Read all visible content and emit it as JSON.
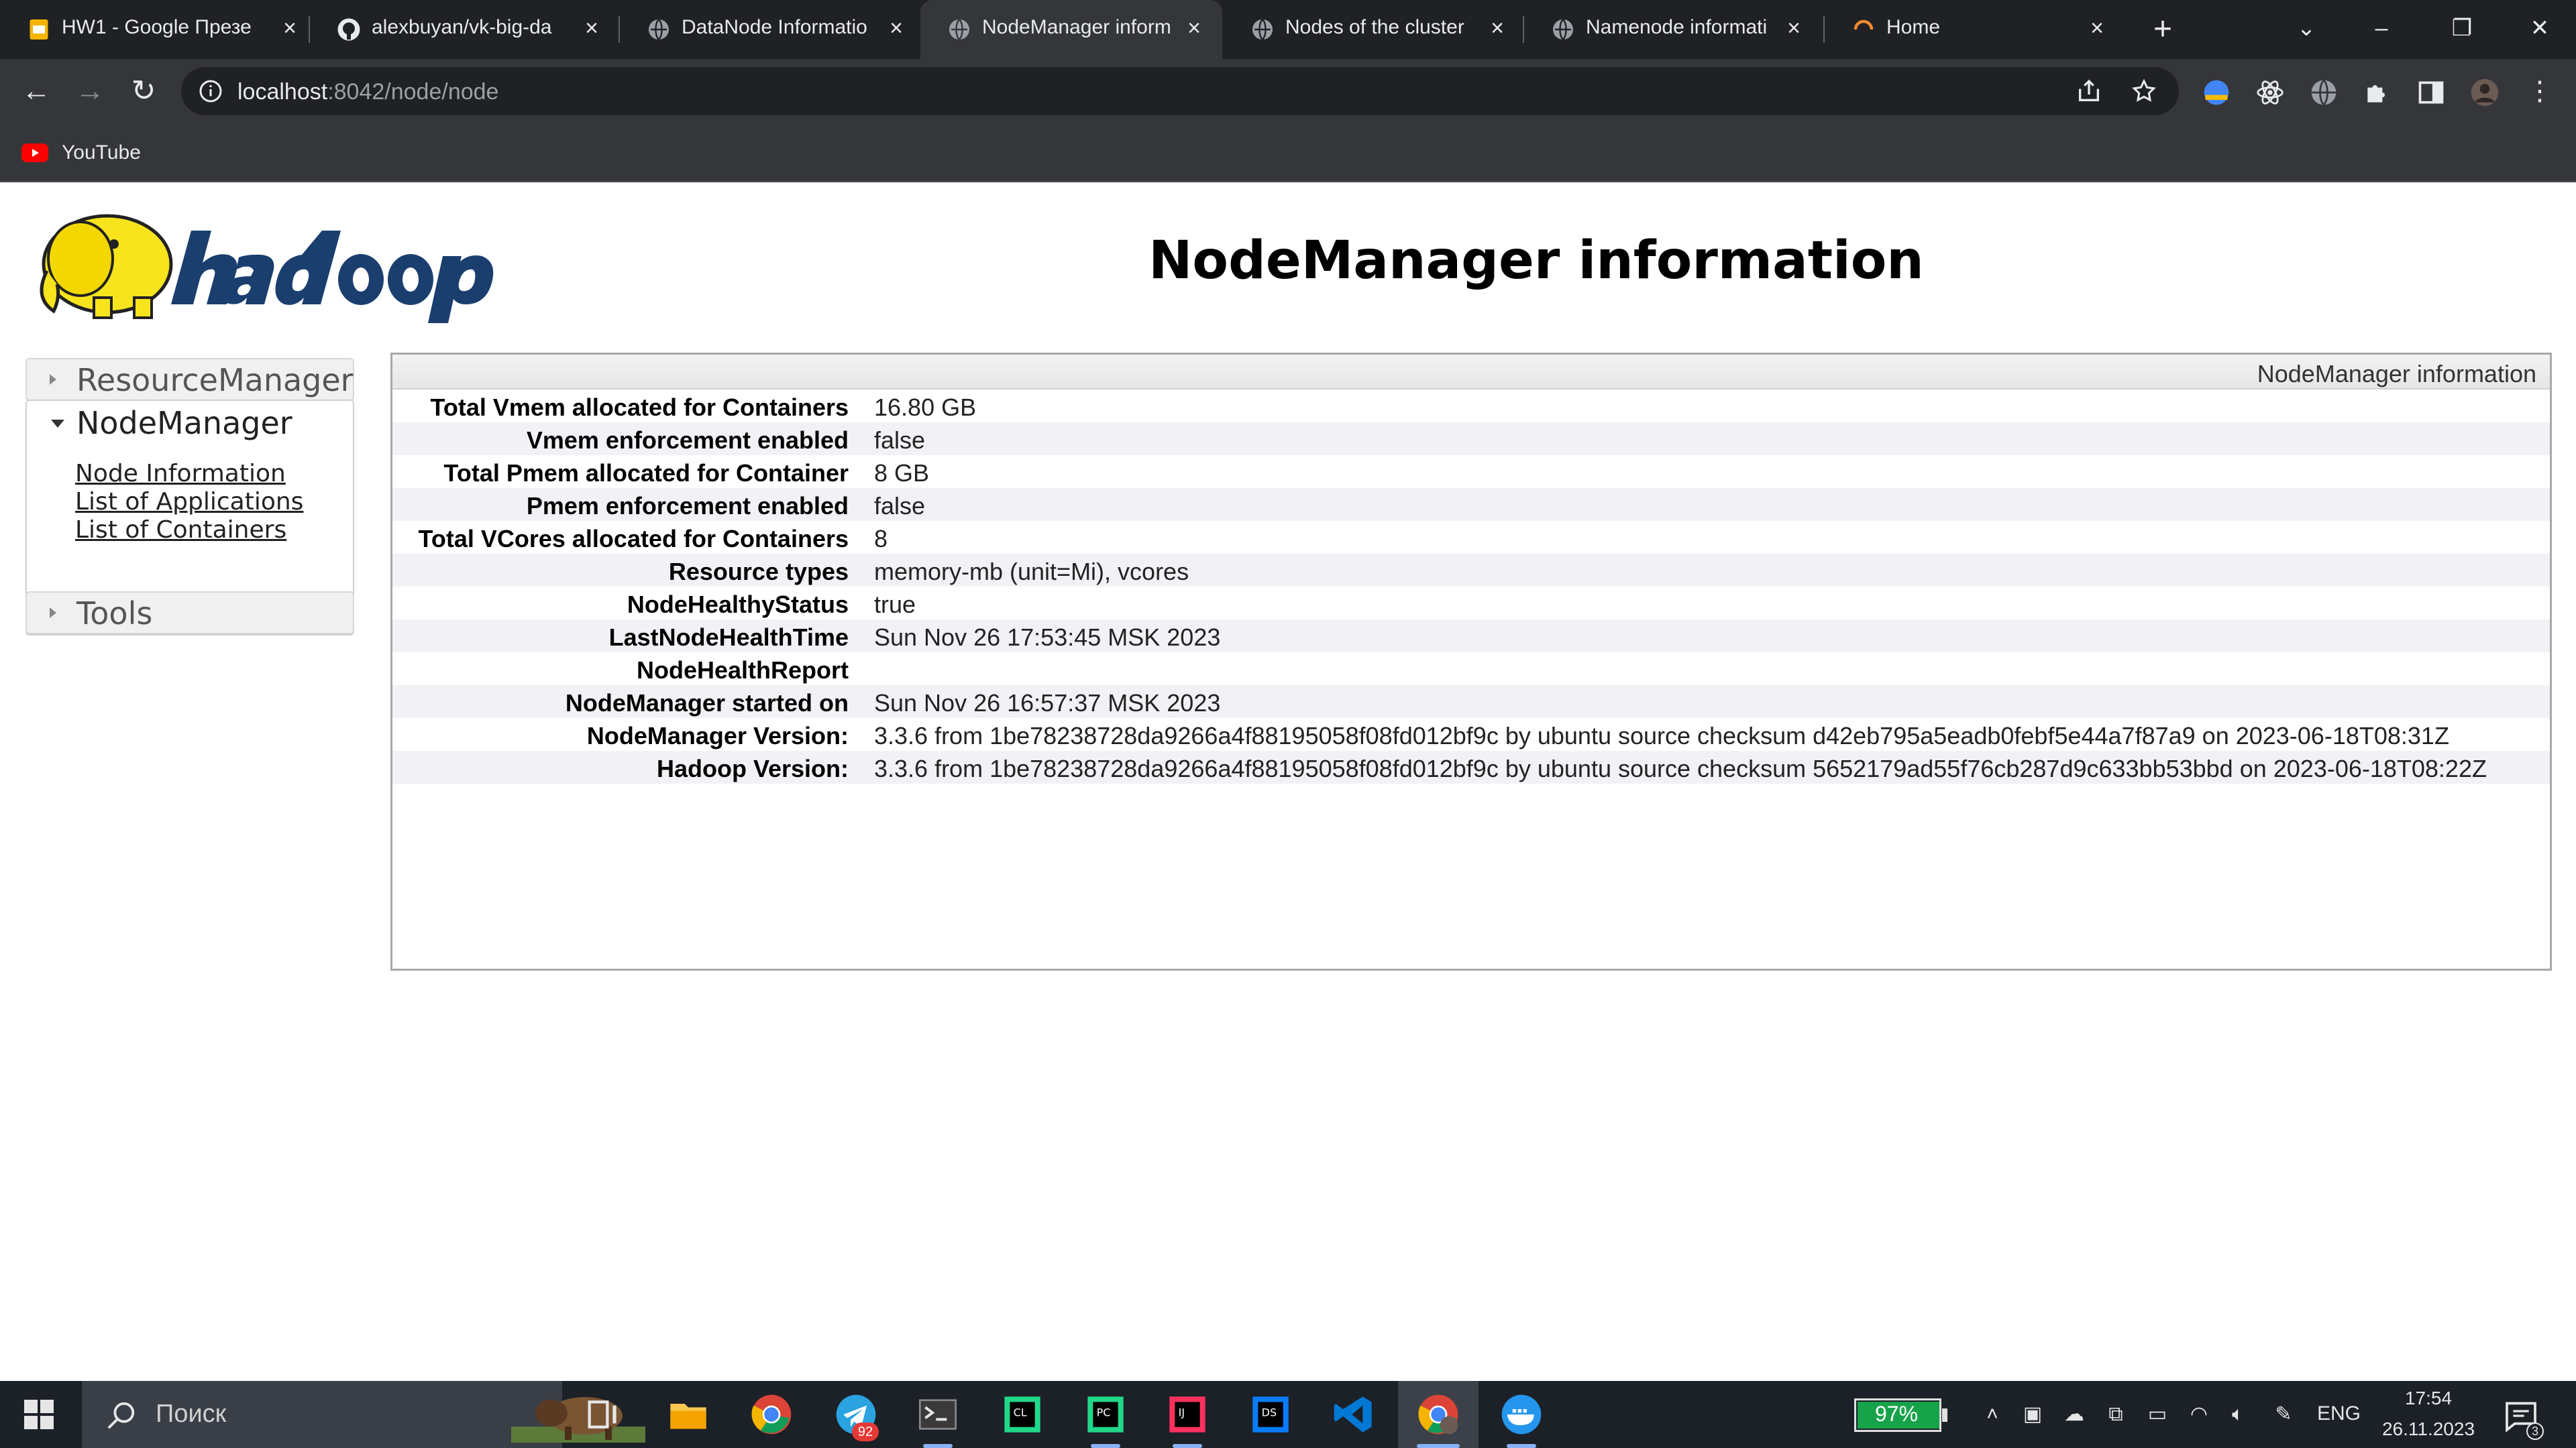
{
  "browser": {
    "tabs": [
      {
        "title": "HW1 - Google Презе",
        "favicon": "google-slides-icon"
      },
      {
        "title": "alexbuyan/vk-big-da",
        "favicon": "github-icon"
      },
      {
        "title": "DataNode Informatio",
        "favicon": "globe-icon"
      },
      {
        "title": "NodeManager inform",
        "favicon": "globe-icon",
        "active": true
      },
      {
        "title": "Nodes of the cluster",
        "favicon": "globe-icon"
      },
      {
        "title": "Namenode informati",
        "favicon": "globe-icon"
      },
      {
        "title": "Home",
        "favicon": "loading-icon"
      }
    ],
    "url_host": "localhost",
    "url_rest": ":8042/node/node",
    "bookmarks": [
      {
        "label": "YouTube",
        "icon": "youtube-icon"
      }
    ]
  },
  "page": {
    "title": "NodeManager information",
    "nav": {
      "resourcemanager": "ResourceManager",
      "nodemanager": "NodeManager",
      "links": [
        "Node Information",
        "List of Applications",
        "List of Containers"
      ],
      "tools": "Tools"
    },
    "info_caption": "NodeManager information",
    "info_rows": [
      {
        "key": "Total Vmem allocated for Containers",
        "value": "16.80 GB"
      },
      {
        "key": "Vmem enforcement enabled",
        "value": "false"
      },
      {
        "key": "Total Pmem allocated for Container",
        "value": "8 GB"
      },
      {
        "key": "Pmem enforcement enabled",
        "value": "false"
      },
      {
        "key": "Total VCores allocated for Containers",
        "value": "8"
      },
      {
        "key": "Resource types",
        "value": "memory-mb (unit=Mi), vcores"
      },
      {
        "key": "NodeHealthyStatus",
        "value": "true"
      },
      {
        "key": "LastNodeHealthTime",
        "value": "Sun Nov 26 17:53:45 MSK 2023"
      },
      {
        "key": "NodeHealthReport",
        "value": ""
      },
      {
        "key": "NodeManager started on",
        "value": "Sun Nov 26 16:57:37 MSK 2023"
      },
      {
        "key": "NodeManager Version:",
        "value": "3.3.6 from 1be78238728da9266a4f88195058f08fd012bf9c by ubuntu source checksum d42eb795a5eadb0febf5e44a7f87a9 on 2023-06-18T08:31Z"
      },
      {
        "key": "Hadoop Version:",
        "value": "3.3.6 from 1be78238728da9266a4f88195058f08fd012bf9c by ubuntu source checksum 5652179ad55f76cb287d9c633bb53bbd on 2023-06-18T08:22Z"
      }
    ]
  },
  "taskbar": {
    "search_placeholder": "Поиск",
    "telegram_badge": "92",
    "battery": "97%",
    "battery_level": 0.97,
    "language": "ENG",
    "time": "17:54",
    "date": "26.11.2023",
    "notifications": "3"
  },
  "colors": {
    "tab_strip": "#202124",
    "toolbar": "#35363a",
    "taskbar": "#1c2027",
    "battery_green": "#17a34a",
    "table_alt_row": "#f2f2f6"
  }
}
